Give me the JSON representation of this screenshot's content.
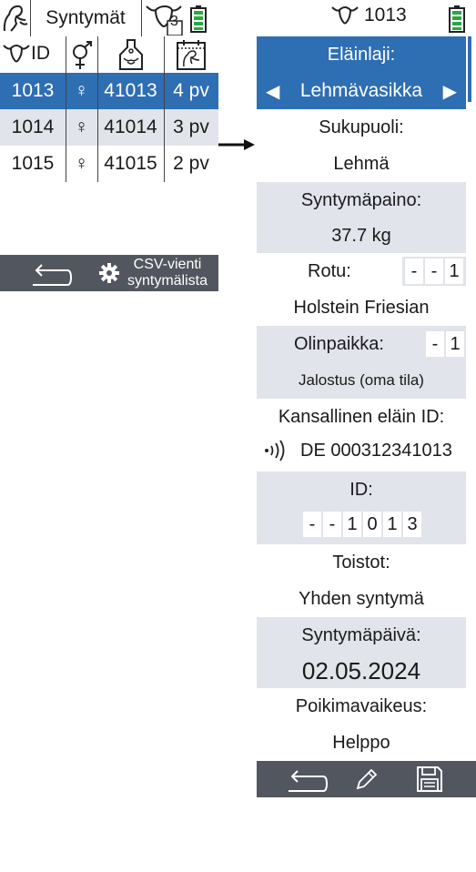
{
  "list": {
    "title": "Syntymät",
    "count_badge": "3",
    "columns": [
      {
        "label": "ID",
        "icon": "cow-head-icon"
      },
      {
        "label": "",
        "icon": "gender-icon"
      },
      {
        "label": "",
        "icon": "ear-tag-icon"
      },
      {
        "label": "",
        "icon": "calendar-calving-icon"
      }
    ],
    "rows": [
      {
        "id": "1013",
        "sex": "♀",
        "tag": "41013",
        "age": "4 pv"
      },
      {
        "id": "1014",
        "sex": "♀",
        "tag": "41014",
        "age": "3 pv"
      },
      {
        "id": "1015",
        "sex": "♀",
        "tag": "41015",
        "age": "2 pv"
      }
    ],
    "export_label_line1": "CSV-vienti",
    "export_label_line2": "syntymälista"
  },
  "detail": {
    "animal_id": "1013",
    "species_label": "Eläinlaji:",
    "species_value": "Lehmävasikka",
    "sex_label": "Sukupuoli:",
    "sex_value": "Lehmä",
    "weight_label": "Syntymäpaino:",
    "weight_value": "37.7 kg",
    "breed_label": "Rotu:",
    "breed_boxes": [
      "-",
      "-",
      "1"
    ],
    "breed_value": "Holstein Friesian",
    "origin_label": "Olinpaikka:",
    "origin_boxes": [
      "-",
      "1"
    ],
    "origin_value": "Jalostus (oma tila)",
    "national_id_label": "Kansallinen eläin ID:",
    "national_id_value": "DE 000312341013",
    "id_label": "ID:",
    "id_boxes": [
      "-",
      "-",
      "1",
      "0",
      "1",
      "3"
    ],
    "repeats_label": "Toistot:",
    "repeats_value": "Yhden syntymä",
    "birth_date_label": "Syntymäpäivä:",
    "birth_date_value": "02.05.2024",
    "calving_label": "Poikimavaikeus:",
    "calving_value": "Helppo"
  },
  "colors": {
    "accent_blue": "#2e6eb3",
    "row_gray": "#e1e4ea",
    "toolbar": "#52565e",
    "battery_green": "#27a844"
  }
}
